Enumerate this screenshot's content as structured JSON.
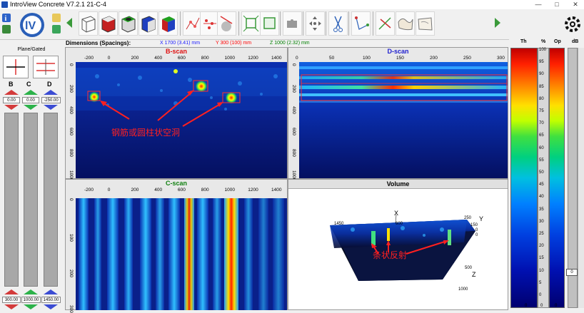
{
  "window": {
    "title": "IntroView Concrete V7.2.1   21-C-4",
    "minimize": "—",
    "maximize": "□",
    "close": "✕"
  },
  "dimensions": {
    "label": "Dimensions (Spacings):",
    "x_text": "X  1700 (3.41) mm",
    "y_text": "Y  300 (100) mm",
    "z_text": "Z  1000 (2.32) mm",
    "x_color": "#1a1aff",
    "y_color": "#ff0000",
    "z_color": "#008000"
  },
  "left_panel": {
    "plane_label": "Plane/Gated",
    "columns": [
      {
        "label": "B",
        "top_value": "0.00",
        "bottom_value": "300.00",
        "color": "#d33b3b"
      },
      {
        "label": "C",
        "top_value": "0.00",
        "bottom_value": "1000.00",
        "color": "#2cb24a"
      },
      {
        "label": "D",
        "top_value": "-250.00",
        "bottom_value": "1450.00",
        "color": "#3b4cd3"
      }
    ]
  },
  "bscan": {
    "title": "B-scan",
    "title_color": "#e01010",
    "x_ticks": [
      "-200",
      "0",
      "200",
      "400",
      "600",
      "800",
      "1000",
      "1200",
      "1400"
    ],
    "y_ticks": [
      "0",
      "200",
      "400",
      "600",
      "800",
      "1000"
    ],
    "annotation": "钢筋或圆柱状空洞"
  },
  "dscan": {
    "title": "D-scan",
    "title_color": "#2020d0",
    "x_ticks": [
      "0",
      "50",
      "100",
      "150",
      "200",
      "250",
      "300"
    ],
    "y_ticks": [
      "0",
      "200",
      "400",
      "600",
      "800",
      "1000"
    ]
  },
  "cscan": {
    "title": "C-scan",
    "title_color": "#108010",
    "x_ticks": [
      "-200",
      "0",
      "200",
      "400",
      "600",
      "800",
      "1000",
      "1200",
      "1400"
    ],
    "y_ticks": [
      "0",
      "100",
      "200",
      "300"
    ]
  },
  "volume": {
    "title": "Volume",
    "axis_x": "X",
    "axis_y": "Y",
    "axis_z": "Z",
    "tick_labels": [
      "1450",
      "600",
      "250",
      "150",
      "0",
      "0",
      "500",
      "1000"
    ],
    "annotation": "条状反射"
  },
  "scale": {
    "headers": [
      "Th",
      "%",
      "Op",
      "dB"
    ],
    "percent_ticks": [
      "100",
      "95",
      "90",
      "85",
      "80",
      "75",
      "70",
      "65",
      "60",
      "55",
      "50",
      "45",
      "40",
      "35",
      "30",
      "25",
      "20",
      "15",
      "10",
      "5",
      "0"
    ],
    "db_value": "0",
    "bottom_values": [
      "0",
      "0",
      "0"
    ]
  }
}
